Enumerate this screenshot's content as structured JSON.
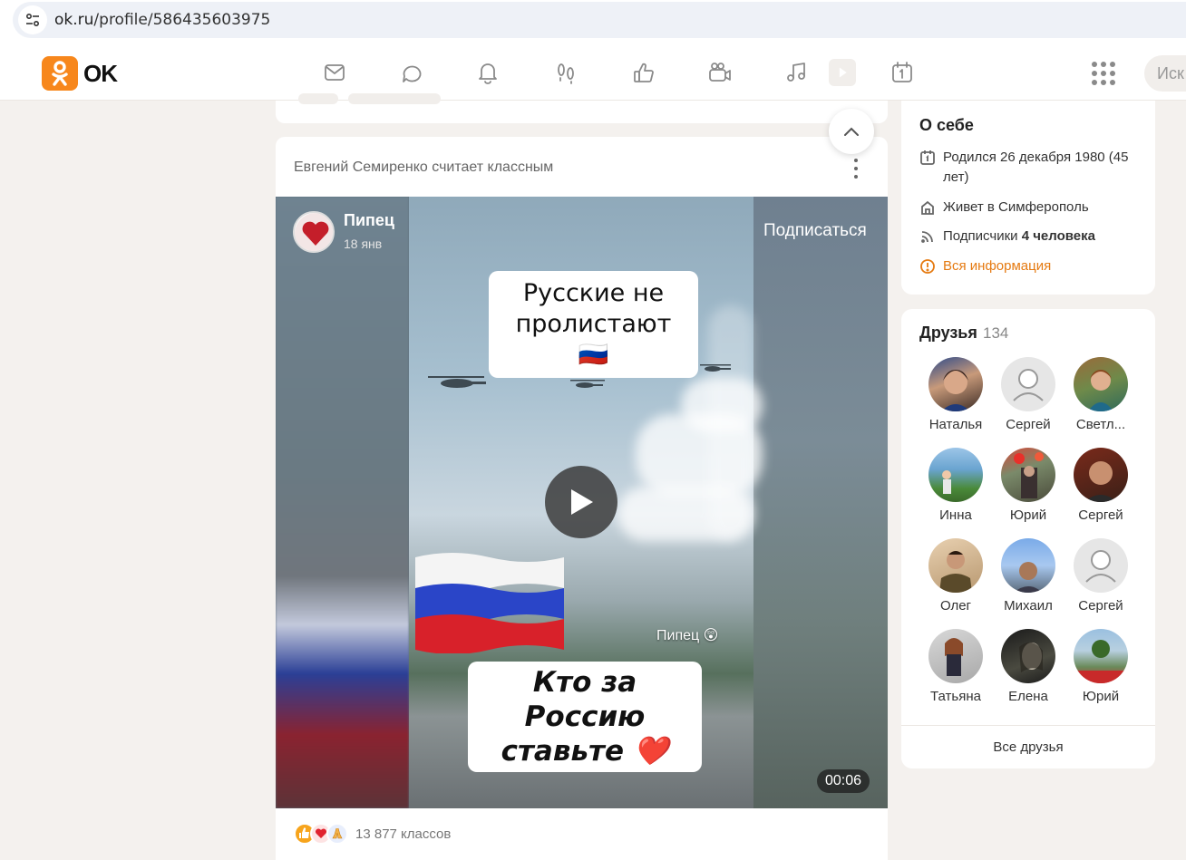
{
  "browser": {
    "url_host": "ok.ru",
    "url_path": "/profile/586435603975"
  },
  "header": {
    "logo_text": "OK",
    "search_placeholder": "Иск",
    "nav_icons": [
      "mail-icon",
      "chat-icon",
      "bell-icon",
      "footprints-icon",
      "like-icon",
      "video-camera-icon",
      "music-icon",
      "video-play-icon",
      "calendar-icon"
    ]
  },
  "post": {
    "header_text": "Евгений Семиренко считает классным",
    "channel_name": "Пипец",
    "channel_date": "18 янв",
    "subscribe_label": "Подписаться",
    "caption_top": "Русские не пролистают 🇷🇺",
    "caption_bottom": "Кто за Россию ставьте ❤️",
    "watermark": "Пипец 😲",
    "duration": "00:06",
    "likes_text": "13 877 классов"
  },
  "about": {
    "title": "О себе",
    "born": "Родился 26 декабря 1980 (45 лет)",
    "lives": "Живет в Симферополь",
    "subscribers_prefix": "Подписчики ",
    "subscribers_count": "4 человека",
    "all_info": "Вся информация"
  },
  "friends": {
    "title": "Друзья",
    "count": "134",
    "items": [
      {
        "name": "Наталья"
      },
      {
        "name": "Сергей"
      },
      {
        "name": "Светл..."
      },
      {
        "name": "Инна"
      },
      {
        "name": "Юрий"
      },
      {
        "name": "Сергей"
      },
      {
        "name": "Олег"
      },
      {
        "name": "Михаил"
      },
      {
        "name": "Сергей"
      },
      {
        "name": "Татьяна"
      },
      {
        "name": "Елена"
      },
      {
        "name": "Юрий"
      }
    ],
    "all_label": "Все друзья"
  },
  "colors": {
    "brand": "#f7871c",
    "link": "#e57a11"
  }
}
